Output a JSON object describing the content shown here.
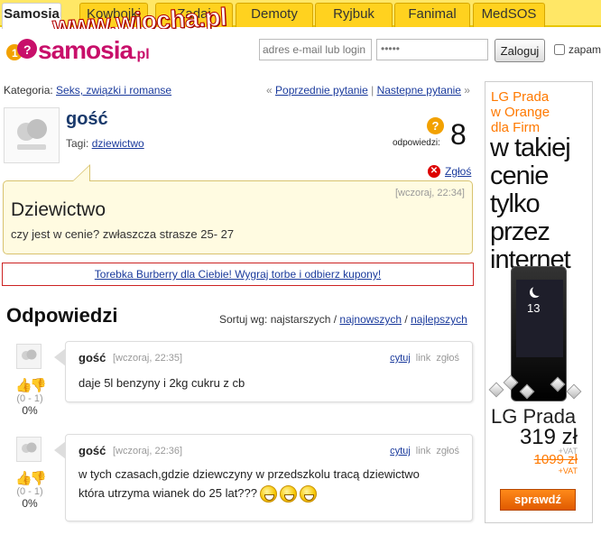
{
  "tabs": [
    {
      "label": "Samosia",
      "active": true
    },
    {
      "label": "Kowbojki",
      "active": false
    },
    {
      "label": "Zadaj",
      "active": false
    },
    {
      "label": "Demoty",
      "active": false
    },
    {
      "label": "Ryjbuk",
      "active": false
    },
    {
      "label": "Fanimal",
      "active": false
    },
    {
      "label": "MedSOS",
      "active": false
    }
  ],
  "watermark": "www.wiocha.pl",
  "logo": {
    "text": "samosia",
    "tld": ".pl"
  },
  "login": {
    "email_placeholder": "adres e-mail lub login",
    "password_value": "•••••",
    "button": "Zaloguj",
    "remember": "zapam"
  },
  "breadcrumb": {
    "label": "Kategoria: ",
    "category": "Seks, związki i romanse",
    "prev_arrow": "« ",
    "prev": "Poprzednie pytanie",
    "sep": " | ",
    "next": "Nastepne pytanie",
    "next_arrow": " »"
  },
  "question": {
    "author": "gość",
    "tags_label": "Tagi: ",
    "tag": "dziewictwo",
    "answers_label": "odpowiedzi:",
    "answers_count": "8",
    "answers_icon": "?",
    "report": "Zgłoś",
    "time": "[wczoraj, 22:34]",
    "title": "Dziewictwo",
    "body": "czy jest w cenie? zwłaszcza strasze 25- 27"
  },
  "promo_link": "Torebka Burberry dla Ciebie! Wygraj torbe i odbierz kupony!",
  "answers_section": {
    "title": "Odpowiedzi",
    "sort_label": "Sortuj wg: najstarszych / ",
    "sort_newest": "najnowszych",
    "sort_sep": " / ",
    "sort_best": "najlepszych"
  },
  "answers": [
    {
      "author": "gość",
      "time": "[wczoraj, 22:35]",
      "actions": [
        "cytuj",
        "link",
        "zgłoś"
      ],
      "text": "daje 5l benzyny i 2kg cukru z cb",
      "vote_count": "(0 - 1)",
      "vote_pct": "0%"
    },
    {
      "author": "gość",
      "time": "[wczoraj, 22:36]",
      "actions": [
        "cytuj",
        "link",
        "zgłoś"
      ],
      "text_line1": "w tych czasach,gdzie dziewczyny w przedszkolu tracą dziewictwo",
      "text_line2": "która utrzyma wianek do 25 lat???",
      "vote_count": "(0 - 1)",
      "vote_pct": "0%"
    }
  ],
  "banner": {
    "head_lines": [
      "LG Prada",
      "w Orange",
      "dla Firm"
    ],
    "slogan_lines": [
      "w takiej",
      "cenie",
      "tylko",
      "przez",
      "internet"
    ],
    "phone_clock": "13",
    "model": "LG Prada",
    "price": "319 zł",
    "vat1": "+VAT",
    "old_price": "1099 zł",
    "vat2": "+VAT",
    "button": "sprawdź"
  },
  "colors": {
    "tab_bar": "#ffe766",
    "tab": "#ffd21f",
    "brand": "#c80f6a",
    "link": "#1a3a9c",
    "question_bg": "#fffbe1",
    "orange": "#ff7900"
  }
}
